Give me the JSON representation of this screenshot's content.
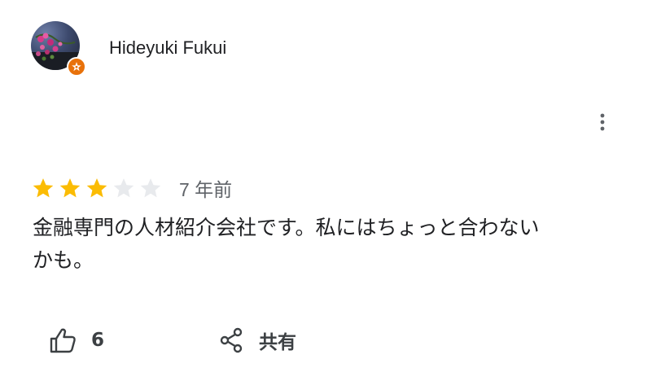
{
  "review": {
    "author": "Hideyuki Fukui",
    "rating": 3,
    "rating_max": 5,
    "date": "7 年前",
    "text_line1": "金融専門の人材紹介会社です。私にはちょっと合わない",
    "text_line2": "かも。"
  },
  "actions": {
    "like_count": "6",
    "share_label": "共有"
  },
  "icons": {
    "avatar": "avatar",
    "badge": "local-guide-star-icon",
    "more": "more-vert-icon",
    "like": "thumb-up-icon",
    "share": "share-icon"
  },
  "colors": {
    "star_filled": "#fbbc04",
    "star_empty": "#e8eaed",
    "badge": "#e8710a"
  }
}
